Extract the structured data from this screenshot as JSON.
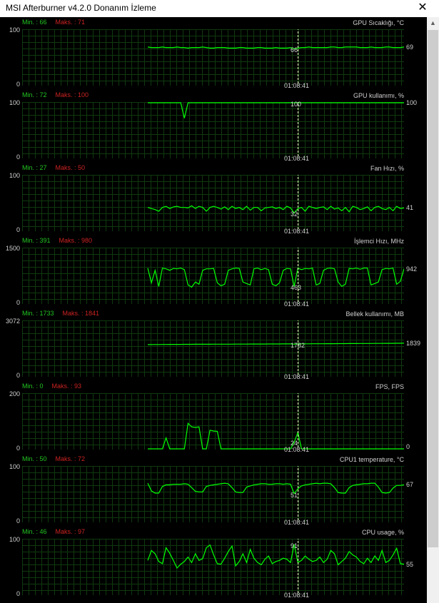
{
  "window": {
    "title": "MSI Afterburner v4.2.0 Donanım İzleme",
    "close_glyph": "✕"
  },
  "cursor_time": "01:08:41",
  "line_color": "#00ff00",
  "panels": [
    {
      "name": "GPU Sıcaklığı, °C",
      "min_label": "Min. : 66",
      "max_label": "Maks. : 71",
      "ymax": "100",
      "ymin": "0",
      "cursor_value": "66",
      "last_value": "69",
      "range": [
        0,
        100
      ],
      "values": [
        69,
        68,
        68,
        68,
        69,
        68,
        68,
        68,
        69,
        68,
        68,
        67,
        68,
        68,
        68,
        69,
        68,
        67,
        67,
        68,
        68,
        68,
        67,
        67,
        67,
        68,
        68,
        67,
        67,
        67,
        68,
        68,
        67,
        67,
        67,
        68,
        67,
        67,
        67,
        68,
        66,
        67,
        68,
        68,
        69,
        68,
        68,
        68,
        68,
        68,
        69,
        69,
        68,
        68,
        69,
        69,
        69,
        69,
        68,
        68,
        68,
        69,
        68,
        68,
        68,
        69,
        69,
        68,
        68,
        68,
        69
      ]
    },
    {
      "name": "GPU kullanımı, %",
      "min_label": "Min. : 72",
      "max_label": "Maks. : 100",
      "ymax": "100",
      "ymin": "0",
      "cursor_value": "100",
      "last_value": "100",
      "range": [
        0,
        100
      ],
      "values": [
        100,
        100,
        100,
        100,
        100,
        100,
        100,
        100,
        100,
        100,
        72,
        100,
        100,
        100,
        100,
        100,
        100,
        100,
        100,
        100,
        100,
        100,
        100,
        100,
        100,
        100,
        100,
        100,
        100,
        100,
        100,
        100,
        100,
        100,
        100,
        100,
        100,
        100,
        100,
        100,
        100,
        100,
        100,
        100,
        100,
        100,
        100,
        100,
        100,
        100,
        100,
        100,
        100,
        100,
        100,
        100,
        100,
        100,
        100,
        100,
        100,
        100,
        100,
        100,
        100,
        100,
        100,
        100,
        100,
        100,
        100
      ]
    },
    {
      "name": "Fan Hızı, %",
      "min_label": "Min. : 27",
      "max_label": "Maks. : 50",
      "ymax": "100",
      "ymin": "0",
      "cursor_value": "32",
      "last_value": "41",
      "range": [
        0,
        100
      ],
      "values": [
        42,
        40,
        38,
        35,
        42,
        44,
        40,
        43,
        44,
        42,
        42,
        41,
        45,
        40,
        44,
        42,
        35,
        42,
        44,
        42,
        39,
        43,
        38,
        44,
        40,
        42,
        38,
        44,
        37,
        42,
        42,
        36,
        41,
        42,
        43,
        40,
        42,
        38,
        44,
        41,
        32,
        40,
        42,
        35,
        44,
        42,
        40,
        42,
        43,
        38,
        44,
        39,
        41,
        36,
        42,
        34,
        44,
        42,
        38,
        40,
        43,
        36,
        42,
        44,
        40,
        38,
        42,
        36,
        44,
        40,
        41
      ]
    },
    {
      "name": "İşlemci Hızı, MHz",
      "min_label": "Min. : 391",
      "max_label": "Maks. : 980",
      "ymax": "1500",
      "ymin": "0",
      "cursor_value": "463",
      "last_value": "942",
      "range": [
        0,
        1500
      ],
      "values": [
        960,
        560,
        900,
        460,
        960,
        940,
        900,
        950,
        940,
        960,
        920,
        500,
        440,
        580,
        520,
        900,
        940,
        940,
        950,
        560,
        480,
        520,
        900,
        940,
        960,
        950,
        580,
        540,
        500,
        940,
        960,
        920,
        950,
        920,
        520,
        480,
        560,
        900,
        950,
        940,
        463,
        960,
        920,
        950,
        940,
        960,
        500,
        540,
        900,
        950,
        960,
        940,
        580,
        460,
        520,
        950,
        940,
        960,
        930,
        960,
        960,
        500,
        540,
        580,
        920,
        950,
        940,
        960,
        520,
        600,
        942
      ]
    },
    {
      "name": "Bellek kullanımı, MB",
      "min_label": "Min. : 1733",
      "max_label": "Maks. : 1841",
      "ymax": "3072",
      "ymin": "0",
      "cursor_value": "1782",
      "last_value": "1839",
      "range": [
        0,
        3072
      ],
      "values": [
        1760,
        1762,
        1764,
        1765,
        1766,
        1768,
        1770,
        1770,
        1772,
        1772,
        1775,
        1776,
        1776,
        1778,
        1778,
        1780,
        1780,
        1781,
        1782,
        1782,
        1783,
        1784,
        1785,
        1785,
        1786,
        1787,
        1788,
        1789,
        1790,
        1790,
        1791,
        1792,
        1793,
        1794,
        1795,
        1796,
        1797,
        1798,
        1799,
        1800,
        1782,
        1801,
        1802,
        1804,
        1805,
        1806,
        1807,
        1808,
        1809,
        1810,
        1812,
        1813,
        1814,
        1815,
        1816,
        1818,
        1819,
        1820,
        1822,
        1823,
        1824,
        1825,
        1826,
        1828,
        1829,
        1830,
        1832,
        1833,
        1835,
        1837,
        1839
      ]
    },
    {
      "name": "FPS, FPS",
      "min_label": "Min. : 0",
      "max_label": "Maks. : 93",
      "ymax": "200",
      "ymin": "0",
      "cursor_value": "24",
      "last_value": "0",
      "range": [
        0,
        200
      ],
      "values": [
        0,
        0,
        0,
        0,
        0,
        40,
        0,
        0,
        0,
        0,
        0,
        93,
        80,
        78,
        80,
        0,
        0,
        68,
        65,
        64,
        0,
        0,
        0,
        0,
        0,
        0,
        0,
        0,
        0,
        0,
        0,
        0,
        0,
        0,
        0,
        0,
        0,
        0,
        0,
        0,
        24,
        60,
        0,
        0,
        0,
        0,
        0,
        0,
        0,
        0,
        0,
        0,
        0,
        0,
        0,
        0,
        0,
        0,
        0,
        0,
        0,
        0,
        0,
        0,
        0,
        0,
        0,
        0,
        0,
        0,
        0
      ]
    },
    {
      "name": "CPU1 temperature, °C",
      "min_label": "Min. : 50",
      "max_label": "Maks. : 72",
      "ymax": "100",
      "ymin": "0",
      "cursor_value": "51",
      "last_value": "67",
      "range": [
        0,
        100
      ],
      "values": [
        70,
        56,
        52,
        52,
        64,
        67,
        67,
        68,
        68,
        68,
        69,
        68,
        62,
        55,
        54,
        54,
        64,
        66,
        67,
        68,
        69,
        70,
        69,
        62,
        54,
        53,
        53,
        63,
        65,
        67,
        68,
        69,
        69,
        68,
        68,
        69,
        69,
        68,
        69,
        68,
        51,
        60,
        65,
        67,
        68,
        69,
        70,
        69,
        70,
        70,
        69,
        62,
        53,
        52,
        52,
        62,
        66,
        67,
        68,
        69,
        69,
        70,
        70,
        63,
        53,
        52,
        53,
        61,
        66,
        66,
        67
      ]
    },
    {
      "name": "CPU usage, %",
      "min_label": "Min. : 46",
      "max_label": "Maks. : 97",
      "ymax": "100",
      "ymin": "0",
      "cursor_value": "91",
      "last_value": "55",
      "range": [
        0,
        100
      ],
      "values": [
        62,
        80,
        74,
        60,
        56,
        85,
        75,
        62,
        48,
        55,
        60,
        68,
        58,
        74,
        62,
        65,
        85,
        90,
        72,
        56,
        55,
        66,
        78,
        88,
        52,
        60,
        74,
        58,
        82,
        66,
        58,
        54,
        64,
        70,
        56,
        60,
        62,
        66,
        64,
        58,
        91,
        58,
        62,
        70,
        64,
        60,
        62,
        68,
        58,
        64,
        80,
        74,
        54,
        60,
        66,
        78,
        72,
        68,
        60,
        56,
        66,
        58,
        70,
        62,
        80,
        58,
        62,
        72,
        84,
        56,
        55
      ]
    }
  ]
}
